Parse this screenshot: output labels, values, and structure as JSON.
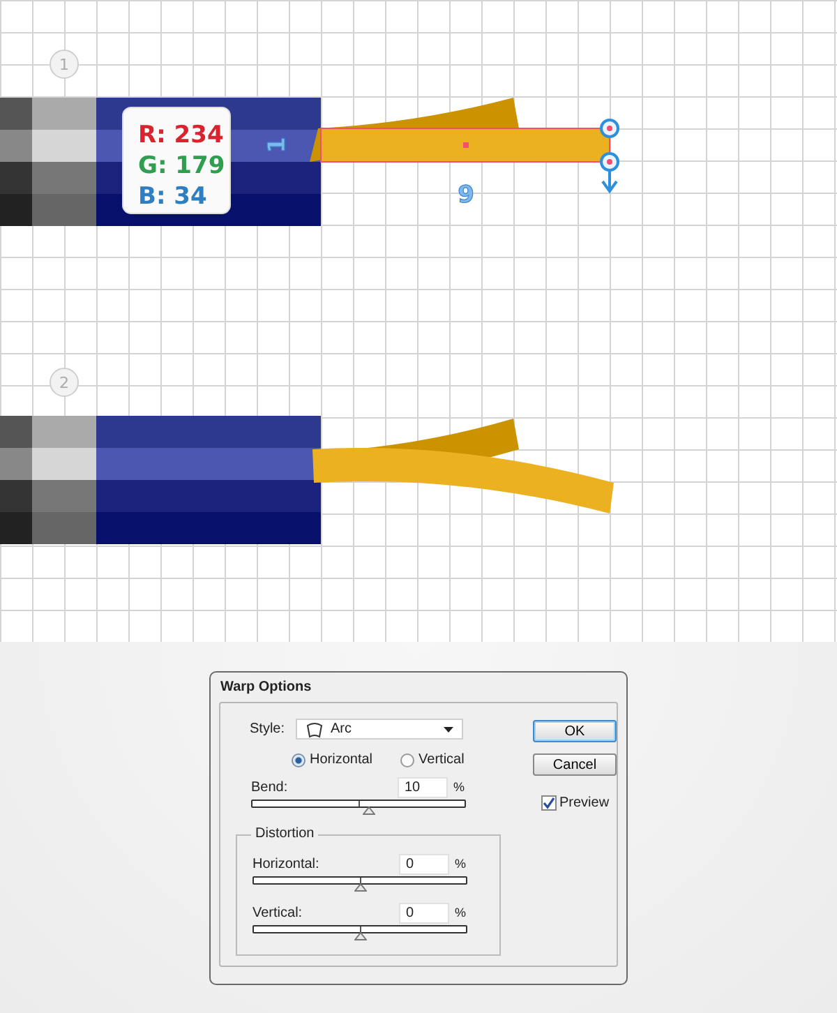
{
  "canvas": {
    "steps": [
      {
        "badge": "1",
        "warped": false,
        "color_card": [
          {
            "text": "R: 234",
            "color": "#d8242e"
          },
          {
            "text": "G: 179",
            "color": "#2f9e4f"
          },
          {
            "text": "B: 34",
            "color": "#2e7fc2"
          }
        ],
        "height_label": "1",
        "width_label": "9"
      },
      {
        "badge": "2",
        "warped": true
      }
    ]
  },
  "dialog": {
    "title": "Warp Options",
    "style": {
      "label": "Style:",
      "value": "Arc"
    },
    "orientation": [
      {
        "label": "Horizontal",
        "selected": true
      },
      {
        "label": "Vertical",
        "selected": false
      }
    ],
    "bend": {
      "label": "Bend:",
      "value": "10",
      "unit": "%",
      "level": 0.55
    },
    "distortion": {
      "title": "Distortion",
      "sliders": [
        {
          "label": "Horizontal:",
          "value": "0",
          "unit": "%",
          "level": 0.5
        },
        {
          "label": "Vertical:",
          "value": "0",
          "unit": "%",
          "level": 0.5
        }
      ]
    },
    "buttons": [
      {
        "label": "OK",
        "default": true
      },
      {
        "label": "Cancel",
        "default": false
      }
    ],
    "preview": {
      "label": "Preview",
      "checked": true
    }
  }
}
